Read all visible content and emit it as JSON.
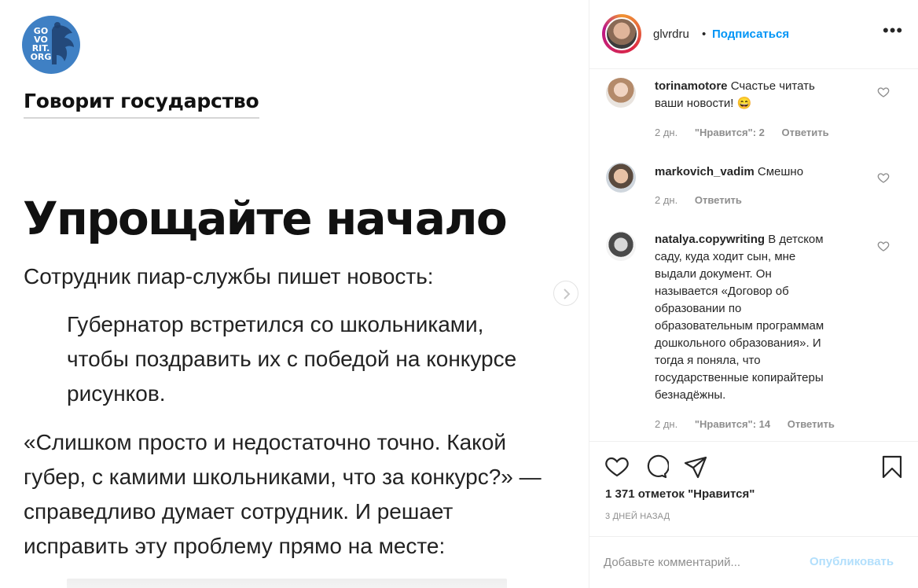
{
  "post_image": {
    "logo_text": "GO VO RIT. ORG",
    "brand": "Говорит государство",
    "heading": "Упрощайте начало",
    "lead": "Сотрудник пиар-службы пишет новость:",
    "quote_lines": [
      "Губернатор встретился со школьниками,",
      "чтобы поздравить их с победой на конкурсе",
      "рисунков."
    ],
    "body_lines": [
      "«Слишком просто и недостаточно точно. Какой",
      "губер, с камими школьниками, что за конкурс?» —",
      "справедливо думает сотрудник. И решает",
      "исправить эту проблему прямо на месте:"
    ]
  },
  "header": {
    "username": "glvrdru",
    "dot": "•",
    "follow_label": "Подписаться",
    "more_label": "•••"
  },
  "comments": [
    {
      "username": "torinamotore",
      "text_lines": [
        "Счастье читать",
        "ваши новости! 😄"
      ],
      "time": "2 дн.",
      "likes": "\"Нравится\": 2",
      "reply": "Ответить"
    },
    {
      "username": "markovich_vadim",
      "text_lines": [
        "Смешно"
      ],
      "time": "2 дн.",
      "reply": "Ответить"
    },
    {
      "username": "natalya.copywriting",
      "text_lines": [
        "В детском",
        "саду, куда ходит сын, мне",
        "выдали документ. Он",
        "называется «Договор об",
        "образовании по",
        "образовательным программам",
        "дошкольного образования». И",
        "тогда я поняла, что",
        "государственные копирайтеры",
        "безнадёжны."
      ],
      "time": "2 дн.",
      "likes": "\"Нравится\": 14",
      "reply": "Ответить"
    }
  ],
  "likes_count": "1 371 отметок \"Нравится\"",
  "date": "3 ДНЕЙ НАЗАД",
  "add_comment": {
    "placeholder": "Добавьте комментарий...",
    "publish_label": "Опубликовать"
  },
  "colors": {
    "link_blue": "#0095f6",
    "publish_disabled": "#b2dffc",
    "muted": "#8e8e8e",
    "logo_blue": "#3f80c4"
  }
}
